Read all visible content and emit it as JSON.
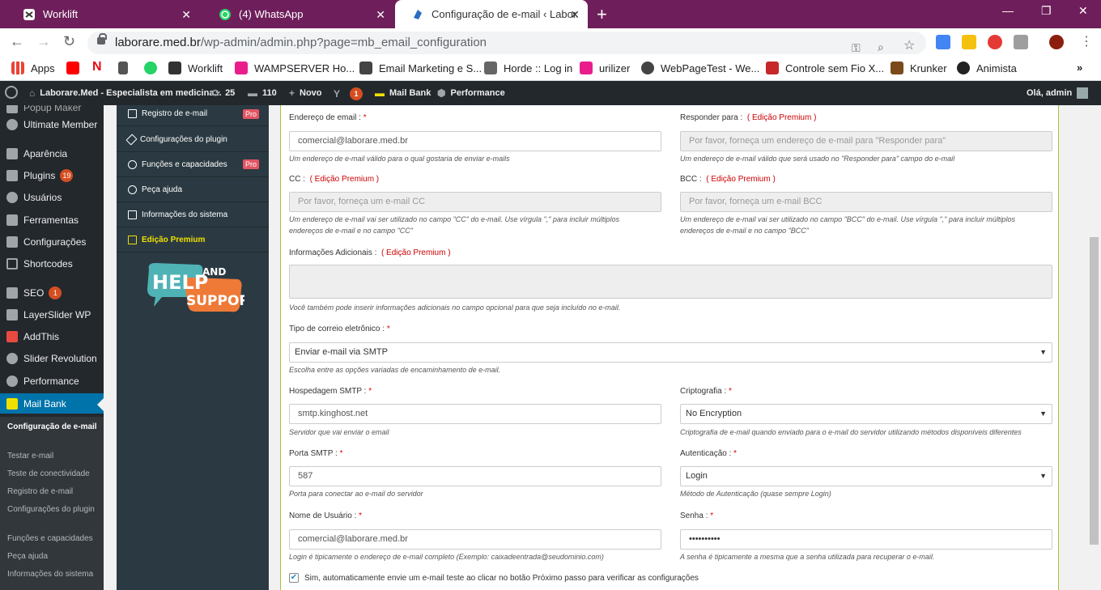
{
  "tabs": [
    {
      "title": "Worklift",
      "icon": "worklift-icon",
      "active": false
    },
    {
      "title": "(4) WhatsApp",
      "icon": "whatsapp-icon",
      "active": false
    },
    {
      "title": "Configuração de e-mail ‹ Laborar",
      "icon": "wordpress-icon",
      "active": true
    }
  ],
  "address": {
    "host": "laborare.med.br",
    "path": "/wp-admin/admin.php?page=mb_email_configuration"
  },
  "bookmarks": [
    "Apps",
    "Worklift",
    "WAMPSERVER Ho...",
    "Email Marketing e S...",
    "Horde :: Log in",
    "urilizer",
    "WebPageTest - We...",
    "Controle sem Fio X...",
    "Krunker",
    "Animista"
  ],
  "adminbar": {
    "site": "Laborare.Med - Especialista em medicina...",
    "updates": "25",
    "comments": "110",
    "new": "Novo",
    "yoast_badge": "1",
    "mailbank": "Mail Bank",
    "performance": "Performance",
    "greeting": "Olá, admin"
  },
  "menu": {
    "partial_top": "Popup Maker",
    "items": [
      "Ultimate Member",
      "Aparência",
      "Plugins",
      "Usuários",
      "Ferramentas",
      "Configurações",
      "Shortcodes",
      "SEO",
      "LayerSlider WP",
      "AddThis",
      "Slider Revolution",
      "Performance",
      "Mail Bank"
    ],
    "plugins_badge": "19",
    "seo_badge": "1",
    "submenu": [
      "Configuração de e-mail",
      "Testar e-mail",
      "Teste de conectividade",
      "Registro de e-mail",
      "Configurações do plugin",
      "Funções e capacidades",
      "Peça ajuda",
      "Informações do sistema"
    ]
  },
  "plugin_nav": {
    "items": [
      "Registro de e-mail",
      "Configurações do plugin",
      "Funções e capacidades",
      "Peça ajuda",
      "Informações do sistema",
      "Edição Premium"
    ],
    "pro_label": "Pro",
    "help_text_1": "HELP",
    "help_text_2": "AND",
    "help_text_3": "SUPPORT"
  },
  "form": {
    "email_label": "Endereço de email :",
    "email_value": "comercial@laborare.med.br",
    "email_hint": "Um endereço de e-mail válido para o qual gostaria de enviar e-mails",
    "reply_label": "Responder para :",
    "premium": "( Edição Premium )",
    "reply_placeholder": "Por favor, forneça um endereço de e-mail para \"Responder para\"",
    "reply_hint": "Um endereço de e-mail válido que será usado no \"Responder para\" campo do e-mail",
    "cc_label": "CC :",
    "cc_placeholder": "Por favor, forneça um e-mail CC",
    "cc_hint": "Um endereço de e-mail vai ser utilizado no campo \"CC\" do e-mail. Use vírgula \",\" para incluir múltiplos endereços de e-mail e no campo \"CC\"",
    "bcc_label": "BCC :",
    "bcc_placeholder": "Por favor, forneça um e-mail BCC",
    "bcc_hint": "Um endereço de e-mail vai ser utilizado no campo \"BCC\" do e-mail. Use vírgula \",\" para incluir múltiplos endereços de e-mail e no campo \"BCC\"",
    "info_label": "Informações Adicionais :",
    "info_hint": "Você também pode inserir informações adicionais no campo opcional para que seja incluído no e-mail.",
    "type_label": "Tipo de correio eletrônico :",
    "type_value": "Enviar e-mail via SMTP",
    "type_hint": "Escolha entre as opções variadas de encaminhamento de e-mail.",
    "host_label": "Hospedagem SMTP :",
    "host_value": "smtp.kinghost.net",
    "host_hint": "Servidor que vai enviar o email",
    "crypto_label": "Criptografia :",
    "crypto_value": "No Encryption",
    "crypto_hint": "Criptografia de e-mail quando enviado para o e-mail do servidor utilizando métodos disponíveis diferentes",
    "port_label": "Porta SMTP :",
    "port_value": "587",
    "port_hint": "Porta para conectar ao e-mail do servidor",
    "auth_label": "Autenticação :",
    "auth_value": "Login",
    "auth_hint": "Método de Autenticação (quase sempre Login)",
    "user_label": "Nome de Usuário :",
    "user_value": "comercial@laborare.med.br",
    "user_hint": "Login é tipicamente o endereço de e-mail completo (Exemplo: caixadeentrada@seudominio.com)",
    "pass_label": "Senha :",
    "pass_value": "••••••••••",
    "pass_hint": "A senha é tipicamente a mesma que a senha utilizada para recuperar o e-mail.",
    "test_checkbox": "Sim, automaticamente envie um e-mail teste ao clicar no botão Próximo passo para verificar as configurações",
    "required_mark": "*"
  }
}
